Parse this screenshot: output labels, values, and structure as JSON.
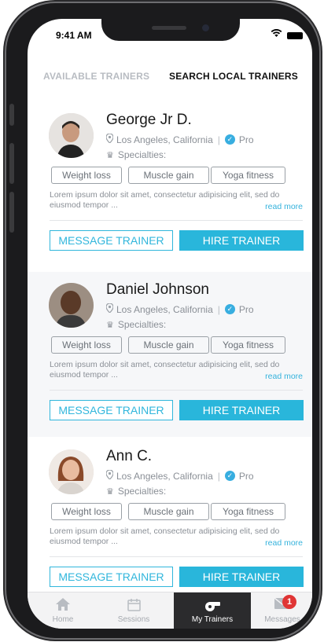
{
  "status_bar": {
    "time": "9:41 AM",
    "wifi_icon": "wifi-icon",
    "battery_icon": "battery-icon"
  },
  "tabs": [
    {
      "label": "AVAILABLE TRAINERS",
      "active": false
    },
    {
      "label": "SEARCH LOCAL TRAINERS",
      "active": true
    }
  ],
  "trainers": [
    {
      "name": "George Jr D.",
      "location": "Los Angeles, California",
      "badge": "Pro",
      "specialties_label": "Specialties:",
      "tags": [
        "Weight loss",
        "Muscle gain",
        "Yoga fitness"
      ],
      "description": "Lorem ipsum dolor sit amet, consectetur adipisicing elit, sed do eiusmod tempor ...",
      "read_more": "read more",
      "message_label": "MESSAGE TRAINER",
      "hire_label": "HIRE TRAINER"
    },
    {
      "name": "Daniel Johnson",
      "location": "Los Angeles, California",
      "badge": "Pro",
      "specialties_label": "Specialties:",
      "tags": [
        "Weight loss",
        "Muscle gain",
        "Yoga fitness"
      ],
      "description": "Lorem ipsum dolor sit amet, consectetur adipisicing elit, sed do eiusmod tempor ...",
      "read_more": "read more",
      "message_label": "MESSAGE TRAINER",
      "hire_label": "HIRE TRAINER"
    },
    {
      "name": "Ann C.",
      "location": "Los Angeles, California",
      "badge": "Pro",
      "specialties_label": "Specialties:",
      "tags": [
        "Weight loss",
        "Muscle gain",
        "Yoga fitness"
      ],
      "description": "Lorem ipsum dolor sit amet, consectetur adipisicing elit, sed do eiusmod tempor ...",
      "read_more": "read more",
      "message_label": "MESSAGE TRAINER",
      "hire_label": "HIRE TRAINER"
    }
  ],
  "bottom_nav": {
    "items": [
      {
        "label": "Home",
        "icon": "home-icon"
      },
      {
        "label": "Sessions",
        "icon": "calendar-icon"
      },
      {
        "label": "My Trainers",
        "icon": "whistle-icon",
        "active": true
      },
      {
        "label": "Messages",
        "icon": "envelope-icon",
        "badge": "1"
      }
    ]
  },
  "colors": {
    "accent": "#29b6db",
    "badge": "#e03535",
    "active_nav": "#2b2b2d"
  }
}
